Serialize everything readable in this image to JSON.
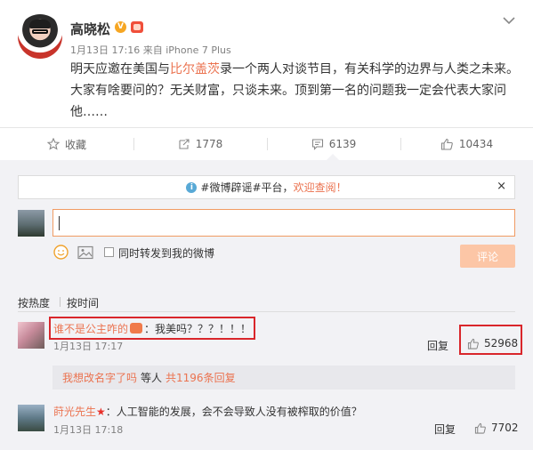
{
  "post": {
    "author": "高晓松",
    "verified_mark": "V",
    "time": "1月13日 17:16",
    "source_prefix": "来自",
    "source": "iPhone 7 Plus",
    "text_before": "明天应邀在美国与",
    "mention": "比尔盖茨",
    "text_after": "录一个两人对谈节目，有关科学的边界与人类之未来。大家有啥要问的？无关财富，只谈未来。顶到第一名的问题我一定会代表大家问他……"
  },
  "actions": {
    "favorite": "收藏",
    "repost_count": "1778",
    "comment_count": "6139",
    "like_count": "10434"
  },
  "rumor_bar": {
    "info_mark": "i",
    "tag": "#微博辟谣#",
    "text": "平台，",
    "highlight": "欢迎查阅！",
    "close": "×"
  },
  "composer": {
    "repost_label": "同时转发到我的微博",
    "submit_label": "评论"
  },
  "sort": {
    "by_hot": "按热度",
    "by_time": "按时间"
  },
  "comments": [
    {
      "user": "谁不是公主咋的",
      "text": "：我美吗？？？！！！",
      "time": "1月13日 17:17",
      "reply_label": "回复",
      "likes": "52968",
      "sub": {
        "user": "我想改名字了吗",
        "middle": "等人",
        "link": "共1196条回复"
      }
    },
    {
      "user": "莳光先生",
      "star": "★",
      "text": "：人工智能的发展，会不会导致人没有被榨取的价值？",
      "time": "1月13日 17:18",
      "reply_label": "回复",
      "likes": "7702"
    }
  ],
  "colors": {
    "accent": "#eb7350",
    "highlight_box": "#d9262b",
    "comment_bg": "#f2f2f5",
    "submit_disabled": "#fcc6a6"
  },
  "icons": [
    "chevron-down-icon",
    "star-outline-icon",
    "repost-icon",
    "comment-icon",
    "thumbs-up-icon",
    "info-icon",
    "close-icon",
    "emoji-icon",
    "image-icon"
  ]
}
